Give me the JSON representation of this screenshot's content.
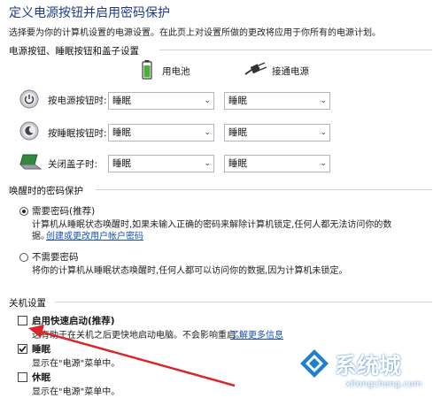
{
  "header": {
    "title": "定义电源按钮并启用密码保护",
    "subtitle": "选择要为你的计算机设置的电源设置。在此页上对设置所做的更改将应用于你所有的电源计划。"
  },
  "power_section": {
    "heading": "电源按钮、睡眠按钮和盖子设置",
    "battery_label": "用电池",
    "plugged_label": "接通电源",
    "rows": [
      {
        "label": "按电源按钮时:",
        "battery_value": "睡眠",
        "plugged_value": "睡眠"
      },
      {
        "label": "按睡眠按钮时:",
        "battery_value": "睡眠",
        "plugged_value": "睡眠"
      },
      {
        "label": "关闭盖子时:",
        "battery_value": "睡眠",
        "plugged_value": "睡眠"
      }
    ]
  },
  "password_section": {
    "heading": "唤醒时的密码保护",
    "option1_label": "需要密码(推荐)",
    "option1_desc": "计算机从睡眠状态唤醒时,如果未输入正确的密码来解除计算机锁定,任何人都无法访问你的数",
    "option1_desc2": "据。",
    "option1_link": "创建或更改用户帐户密码",
    "option2_label": "不需要密码",
    "option2_desc": "将你的计算机从睡眠状态唤醒时,任何人都可以访问你的数据,因为计算机未锁定。"
  },
  "shutdown_section": {
    "heading": "关机设置",
    "fast_startup_label": "启用快速启动(推荐)",
    "fast_startup_desc": "这有助于在关机之后更快地启动电脑。不会影响重启。",
    "fast_startup_link": "了解更多信息",
    "sleep_label": "睡眠",
    "sleep_desc": "显示在\"电源\"菜单中。",
    "hibernate_label": "休眠",
    "hibernate_desc": "显示在\"电源\"菜单中。"
  },
  "watermark": {
    "brand": "系统城",
    "url": "xitongcheng.com"
  }
}
